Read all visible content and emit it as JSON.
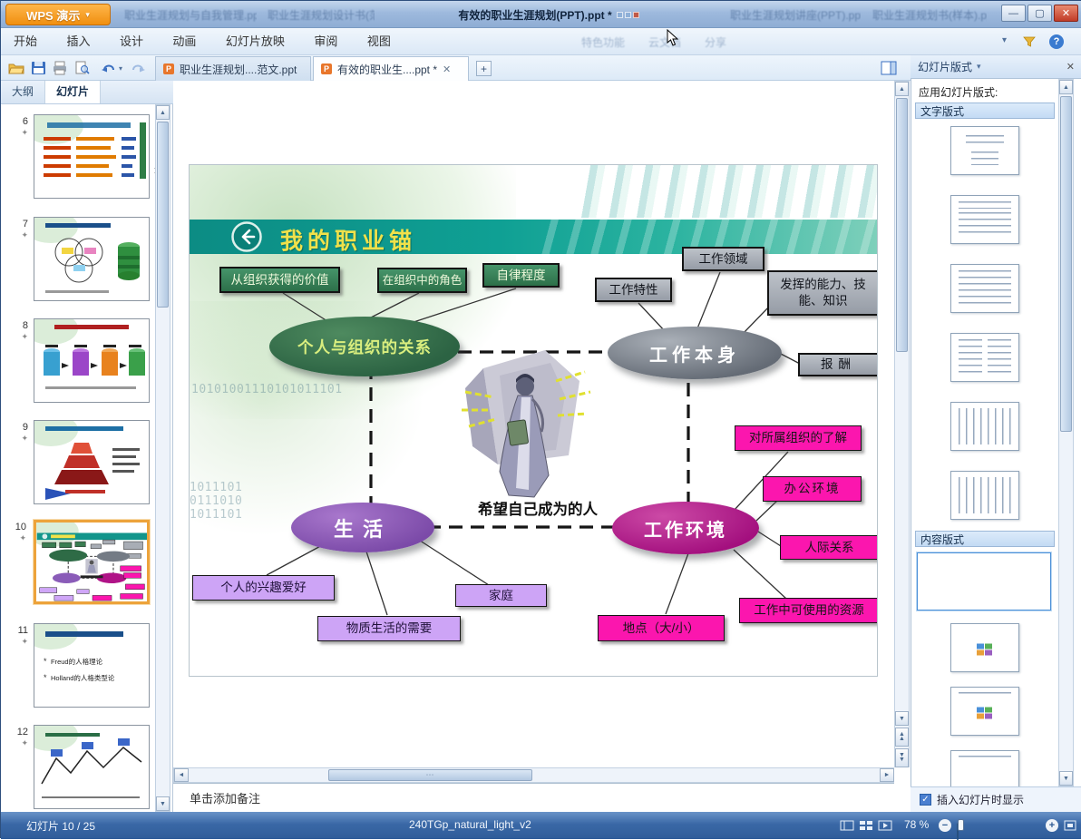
{
  "titlebar": {
    "app_badge": "WPS 演示",
    "tabs": [
      {
        "label": "职业生涯规划与自我管理.ppt"
      },
      {
        "label": "职业生涯规划设计书(范例).ppt"
      },
      {
        "label": "有效的职业生涯规划(PPT).ppt *",
        "active": true
      },
      {
        "label": "职业生涯规划讲座(PPT).ppt"
      },
      {
        "label": "职业生涯规划书(样本).ppt"
      }
    ]
  },
  "menubar": {
    "items": [
      "开始",
      "插入",
      "设计",
      "动画",
      "幻灯片放映",
      "审阅",
      "视图"
    ],
    "faded_items": [
      "特色功能",
      "云文档",
      "分享"
    ]
  },
  "toolbar": {
    "doc_tabs": [
      {
        "label": "职业生涯规划....范文.ppt"
      },
      {
        "label": "有效的职业生....ppt *",
        "active": true
      }
    ],
    "new_tab_label": "+"
  },
  "left_panel": {
    "tabs": [
      {
        "label": "大纲"
      },
      {
        "label": "幻灯片",
        "active": true
      }
    ],
    "slides": [
      {
        "number": "6"
      },
      {
        "number": "7"
      },
      {
        "number": "8"
      },
      {
        "number": "9"
      },
      {
        "number": "10",
        "selected": true
      },
      {
        "number": "11",
        "bullets": [
          "Freud的人格理论",
          "Holland的人格类型论"
        ]
      },
      {
        "number": "12"
      }
    ]
  },
  "slide": {
    "title": "我的职业锚",
    "center_label": "希望自己成为的人",
    "ellipse_org": "个人与组织的关系",
    "ellipse_work": "工作本身",
    "ellipse_life": "生活",
    "ellipse_env": "工作环境",
    "boxes_org": [
      "从组织获得的价值",
      "在组织中的角色",
      "自律程度"
    ],
    "boxes_work": [
      "工作领域",
      "工作特性",
      "发挥的能力、技能、知识",
      "报酬"
    ],
    "boxes_life": [
      "个人的兴趣爱好",
      "物质生活的需要",
      "家庭"
    ],
    "boxes_env": [
      "对所属组织的了解",
      "办公环境",
      "人际关系",
      "工作中可使用的资源",
      "地点（大/小）"
    ],
    "binary_decoration": [
      "10101001110101011101",
      "1011101\n0111010\n1011101"
    ]
  },
  "notes": {
    "placeholder": "单击添加备注"
  },
  "layout_panel": {
    "title": "幻灯片版式",
    "apply_label": "应用幻灯片版式:",
    "sections": [
      {
        "label": "文字版式"
      },
      {
        "label": "内容版式"
      }
    ],
    "checkbox_label": "插入幻灯片时显示"
  },
  "statusbar": {
    "slide_position": "幻灯片 10 / 25",
    "center_text": "240TGp_natural_light_v2",
    "zoom": "78 %"
  },
  "colors": {
    "wps_orange": "#f59a23",
    "band_teal": "#0f9a90",
    "title_yellow": "#f0e14a",
    "ellipse_green": "#2e6b46",
    "ellipse_gray": "#79808b",
    "ellipse_purple": "#8a5cb8",
    "ellipse_magenta": "#b01387",
    "box_magenta": "#fb16ae",
    "box_lavender": "#cda4f6",
    "statusbar_blue": "#33619f"
  }
}
